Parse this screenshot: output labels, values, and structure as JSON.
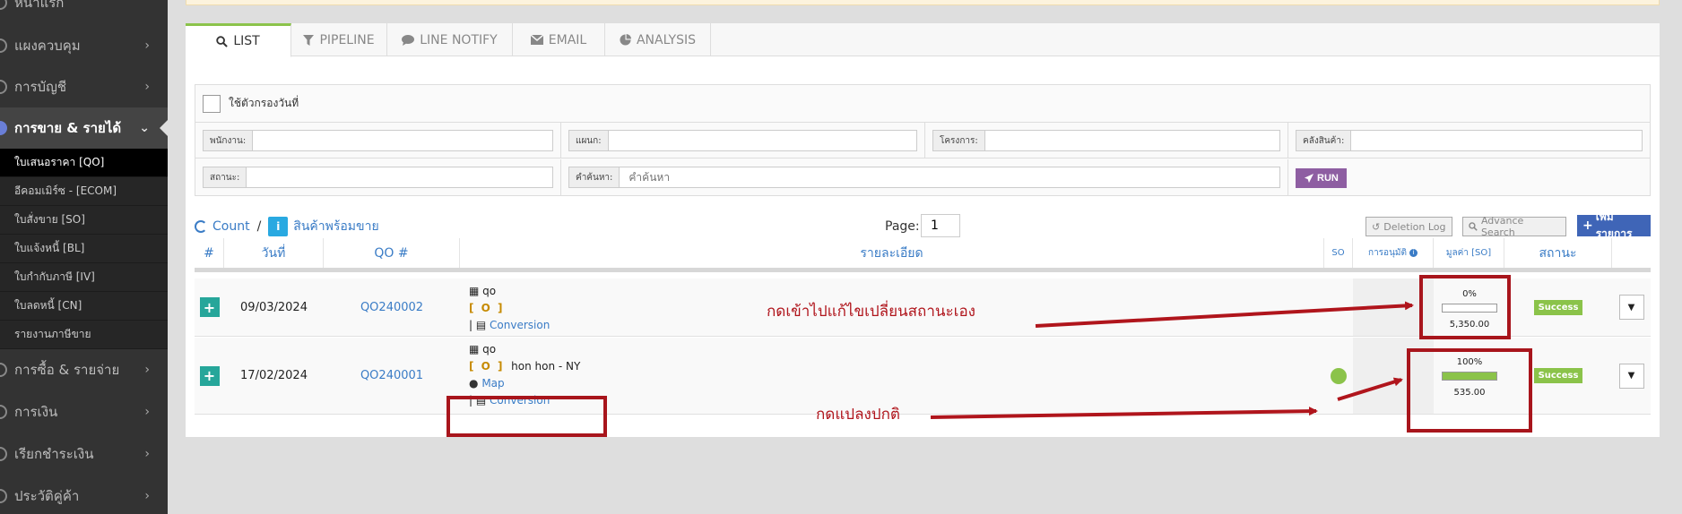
{
  "sidebar": {
    "items": [
      {
        "label": "หน้าแรก"
      },
      {
        "label": "แผงควบคุม"
      },
      {
        "label": "การบัญชี"
      },
      {
        "label": "การขาย & รายได้"
      },
      {
        "label": "การซื้อ & รายจ่าย"
      },
      {
        "label": "การเงิน"
      },
      {
        "label": "เรียกชำระเงิน"
      },
      {
        "label": "ประวัติคู่ค้า"
      }
    ],
    "sub_items": [
      {
        "label": "ใบเสนอราคา [QO]"
      },
      {
        "label": "อีคอมเมิร์ซ - [ECOM]"
      },
      {
        "label": "ใบสั่งขาย [SO]"
      },
      {
        "label": "ใบแจ้งหนี้ [BL]"
      },
      {
        "label": "ใบกำกับภาษี [IV]"
      },
      {
        "label": "ใบลดหนี้ [CN]"
      },
      {
        "label": "รายงานภาษีขาย"
      }
    ]
  },
  "tabs": [
    {
      "label": "LIST"
    },
    {
      "label": "PIPELINE"
    },
    {
      "label": "LINE NOTIFY"
    },
    {
      "label": "EMAIL"
    },
    {
      "label": "ANALYSIS"
    }
  ],
  "filters": {
    "date_filter_label": "ใช้ตัวกรองวันที่",
    "employee_label": "พนักงาน:",
    "department_label": "แผนก:",
    "project_label": "โครงการ:",
    "warehouse_label": "คลังสินค้า:",
    "status_label": "สถานะ:",
    "search_label": "คำค้นหา:",
    "search_placeholder": "คำค้นหา",
    "run_label": "RUN"
  },
  "list_header": {
    "count_label": "Count",
    "separator": "/",
    "ready_label": "สินค้าพร้อมขาย",
    "page_label": "Page:",
    "page_value": "1",
    "deletion_log": "Deletion Log",
    "advance_search": "Advance Search",
    "add_item": "เพิ่มรายการ"
  },
  "columns": {
    "num": "#",
    "date": "วันที่",
    "qo": "QO #",
    "detail": "รายละเอียด",
    "so": "SO",
    "approval": "การอนุมัติ",
    "value_so": "มูลค่า [SO]",
    "status": "สถานะ"
  },
  "rows": [
    {
      "date": "09/03/2024",
      "qo": "QO240002",
      "detail_name": "qo",
      "bracket": "[ O ]",
      "customer": "",
      "map_label": "",
      "conversion": "Conversion",
      "progress_label": "0%",
      "progress": 0,
      "amount": "5,350.00",
      "status": "Success"
    },
    {
      "date": "17/02/2024",
      "qo": "QO240001",
      "detail_name": "qo",
      "bracket": "[ O ]",
      "customer": "hon hon - NY",
      "map_label": "Map",
      "conversion": "Conversion",
      "progress_label": "100%",
      "progress": 100,
      "amount": "535.00",
      "status": "Success"
    }
  ],
  "annotations": {
    "text1": "กดเข้าไปแก้ไขเปลี่ยนสถานะเอง",
    "text2": "กดแปลงปกติ",
    "color": "#b0151c"
  },
  "icons": [
    "search-icon",
    "filter-icon",
    "chat-icon",
    "envelope-icon",
    "pie-chart-icon",
    "rocket-icon",
    "history-icon",
    "plus-icon",
    "info-icon",
    "map-marker-icon",
    "book-icon",
    "list-icon",
    "caret-down-icon"
  ]
}
